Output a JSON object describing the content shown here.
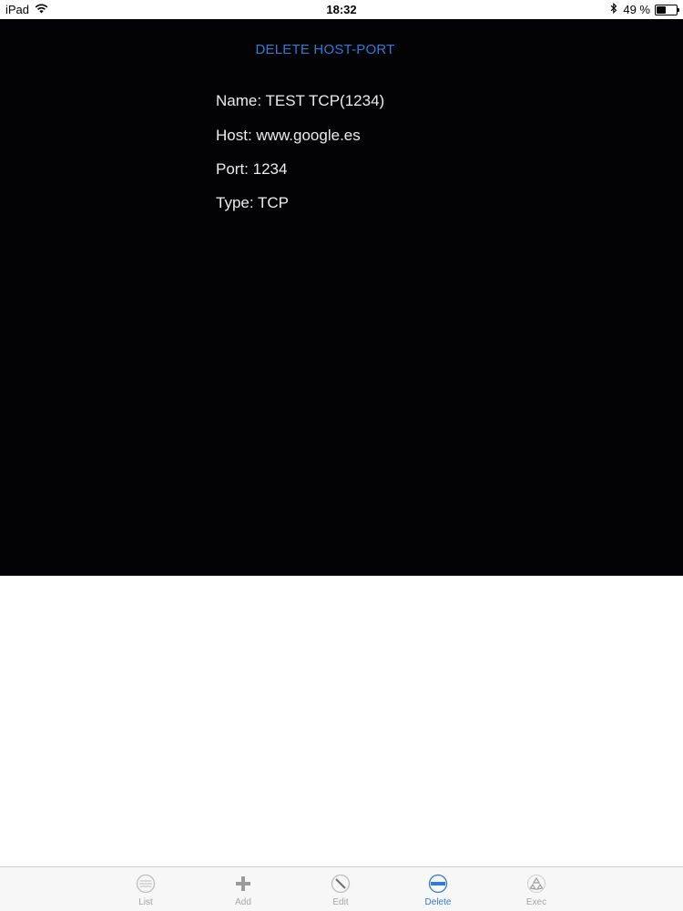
{
  "status_bar": {
    "device": "iPad",
    "time": "18:32",
    "battery_percent": "49 %"
  },
  "detail": {
    "title": "DELETE HOST-PORT",
    "name": "Name: TEST TCP(1234)",
    "host": "Host: www.google.es",
    "port": "Port: 1234",
    "type": "Type: TCP"
  },
  "tabs": [
    {
      "label": "List",
      "icon": "list-icon",
      "active": false
    },
    {
      "label": "Add",
      "icon": "plus-icon",
      "active": false
    },
    {
      "label": "Edit",
      "icon": "edit-icon",
      "active": false
    },
    {
      "label": "Delete",
      "icon": "minus-circle-icon",
      "active": true
    },
    {
      "label": "Exec",
      "icon": "recycle-icon",
      "active": false
    }
  ],
  "colors": {
    "accent": "#2f7bd6",
    "panel_bg": "#030306",
    "inactive_tab": "#a5a5a5"
  }
}
